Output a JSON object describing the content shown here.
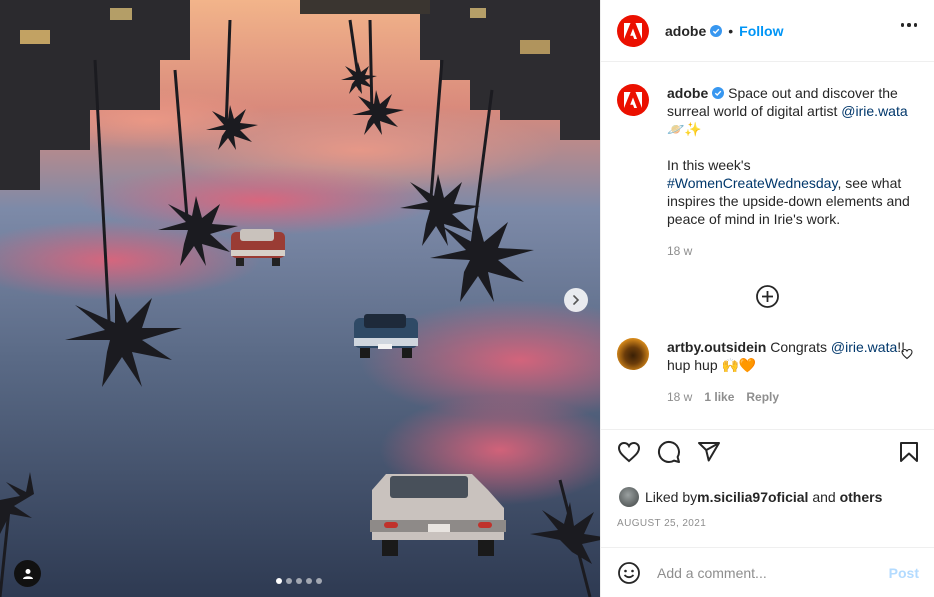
{
  "post": {
    "account": {
      "username": "adobe",
      "verified": true,
      "follow_label": "Follow",
      "separator": "•"
    },
    "media": {
      "carousel_total": 5,
      "carousel_active": 1,
      "next_icon": "chevron-right-icon",
      "tag_icon": "user-tag-icon"
    },
    "caption": {
      "username": "adobe",
      "line1_text": " Space out and discover the surreal world of digital artist ",
      "mention": "@irie.wata",
      "emoji": "🪐✨",
      "line2_text": "In this week's ",
      "hashtag": "#WomenCreateWednesday",
      "line3_text": ", see what inspires the upside-down elements and peace of mind in Irie's work.",
      "time": "18 w"
    },
    "load_more_icon": "plus-circle-icon",
    "comment": {
      "username": "artby.outsidein",
      "text_before": " Congrats ",
      "mention": "@irie.wata",
      "text_after": "!! hup hup ",
      "emoji": "🙌🧡",
      "time": "18 w",
      "likes": "1 like",
      "reply_label": "Reply"
    },
    "likes": {
      "prefix": "Liked by ",
      "user": "m.sicilia97oficial",
      "middle": " and ",
      "others": "others"
    },
    "date": "AUGUST 25, 2021",
    "add_comment": {
      "placeholder": "Add a comment...",
      "post_label": "Post"
    },
    "colors": {
      "brand": "#eb1000",
      "link": "#00376b",
      "follow": "#0095f6",
      "muted": "#8e8e8e",
      "post_disabled": "#b3dbff"
    }
  }
}
